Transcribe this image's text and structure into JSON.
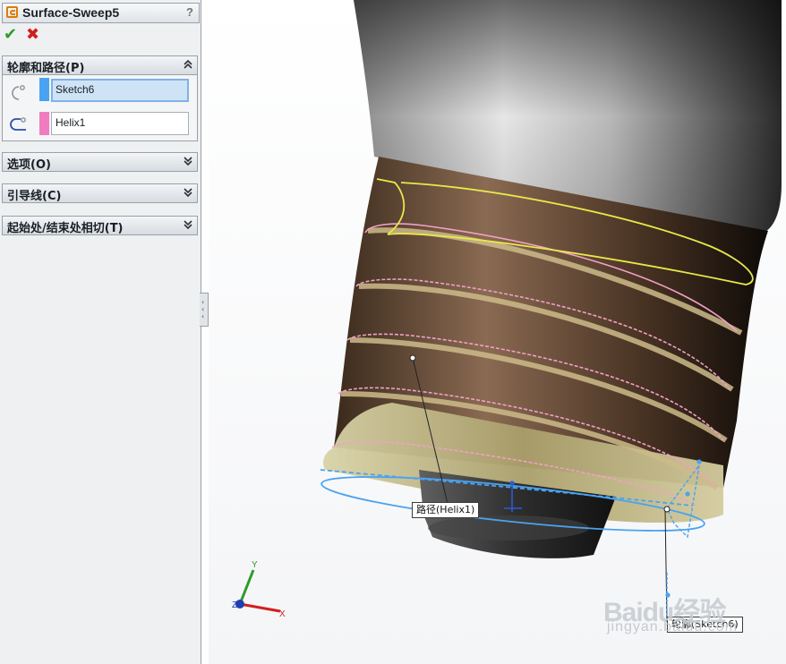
{
  "feature": {
    "title": "Surface-Sweep5",
    "help": "?"
  },
  "actions": {
    "ok": "✔",
    "cancel": "✖"
  },
  "sections": {
    "profile_path": {
      "label": "轮廓和路径(P)",
      "profile_value": "Sketch6",
      "path_value": "Helix1",
      "profile_color": "#4aa3f0",
      "path_color": "#f07cc0"
    },
    "options": {
      "label": "选项(O)"
    },
    "guides": {
      "label": "引导线(C)"
    },
    "tangency": {
      "label": "起始处/结束处相切(T)"
    }
  },
  "viewport": {
    "path_callout": "路径(Helix1)",
    "profile_callout": "轮廓(Sketch6)",
    "triad": {
      "x": "X",
      "y": "Y",
      "z": "Z"
    },
    "watermark": "Baidu经验",
    "watermark_sub": "jingyan.baidu.com"
  },
  "colors": {
    "helix": "#f0a0c8",
    "selection": "#4aa3f0",
    "profile_sketch": "#e8e84a",
    "thread_body": "#7a5a44"
  }
}
